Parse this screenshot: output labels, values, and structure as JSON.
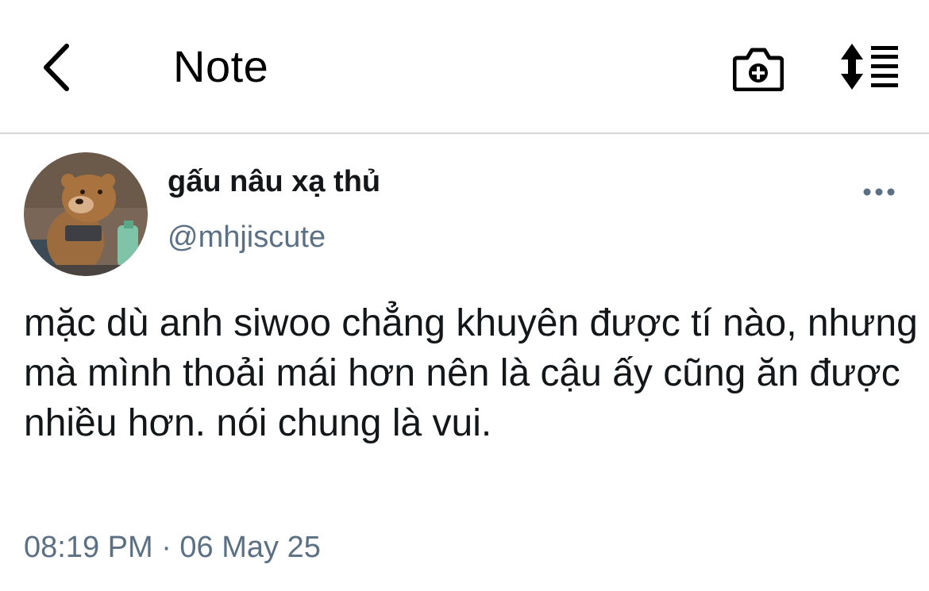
{
  "header": {
    "title": "Note",
    "icons": {
      "back": "chevron-left-icon",
      "camera": "camera-add-icon",
      "sort": "sort-list-icon"
    }
  },
  "tweet": {
    "display_name": "gấu nâu xạ thủ",
    "handle": "@mhjiscute",
    "text": "mặc dù anh siwoo chẳng khuyên được tí nào, nhưng mà mình thoải mái hơn nên là cậu ấy cũng ăn được nhiều hơn. nói chung là vui.",
    "timestamp": "08:19 PM · 06 May 25",
    "avatar": "brown-bear-avatar"
  },
  "colors": {
    "text_primary": "#14171a",
    "text_secondary": "#5b7083",
    "divider": "#d4d4d6"
  }
}
